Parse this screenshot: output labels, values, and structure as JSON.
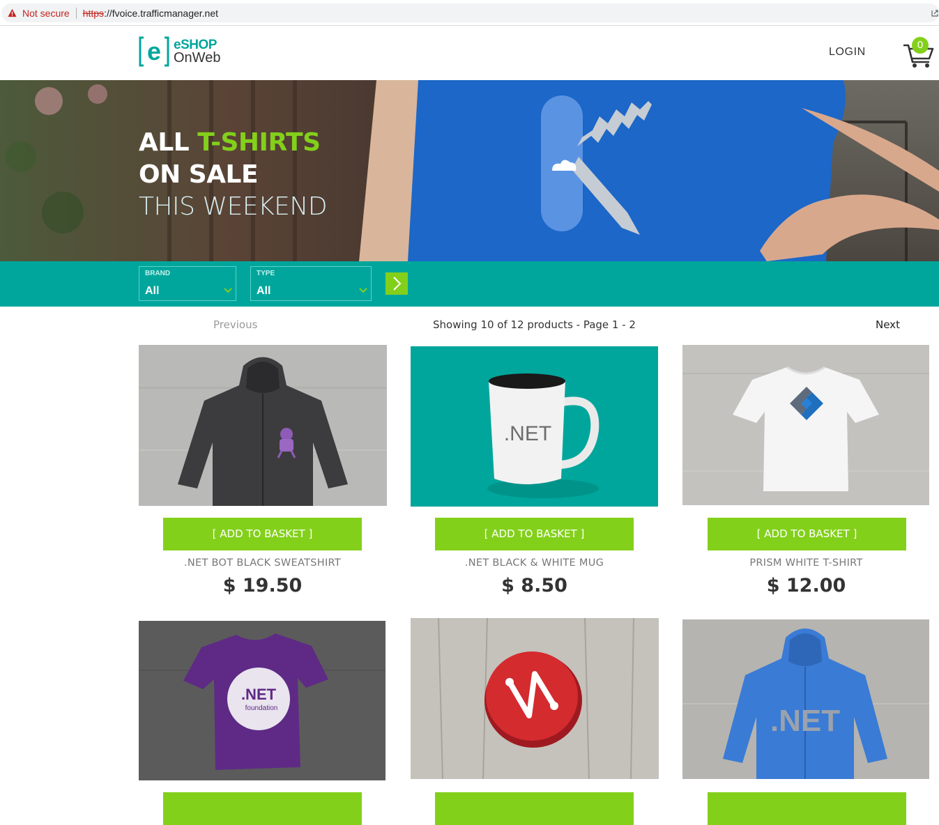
{
  "browser": {
    "security_label": "Not secure",
    "url_scheme": "https",
    "url_rest": "://fvoice.trafficmanager.net"
  },
  "header": {
    "logo_line1": "eSHOP",
    "logo_line2": "OnWeb",
    "login_label": "LOGIN",
    "cart_count": "0"
  },
  "hero": {
    "line1_a": "ALL",
    "line1_b": "T-SHIRTS",
    "line2": "ON SALE",
    "line3": "THIS WEEKEND"
  },
  "filters": {
    "brand": {
      "label": "BRAND",
      "value": "All"
    },
    "type": {
      "label": "TYPE",
      "value": "All"
    }
  },
  "pager": {
    "previous": "Previous",
    "showing": "Showing 10 of 12 products - Page 1 - 2",
    "next": "Next"
  },
  "products": [
    {
      "name": ".NET BOT BLACK SWEATSHIRT",
      "price": "$ 19.50",
      "add_label": "[ ADD TO BASKET ]"
    },
    {
      "name": ".NET BLACK & WHITE MUG",
      "price": "$ 8.50",
      "add_label": "[ ADD TO BASKET ]"
    },
    {
      "name": "PRISM WHITE T-SHIRT",
      "price": "$ 12.00",
      "add_label": "[ ADD TO BASKET ]"
    }
  ],
  "product_art": {
    "mug_text": ".NET",
    "purple_tee_text": ".NET",
    "purple_tee_sub": "foundation",
    "blue_hoodie_text": ".NET"
  },
  "colors": {
    "teal": "#00a69c",
    "green": "#83d01b",
    "text_dark": "#333333"
  }
}
